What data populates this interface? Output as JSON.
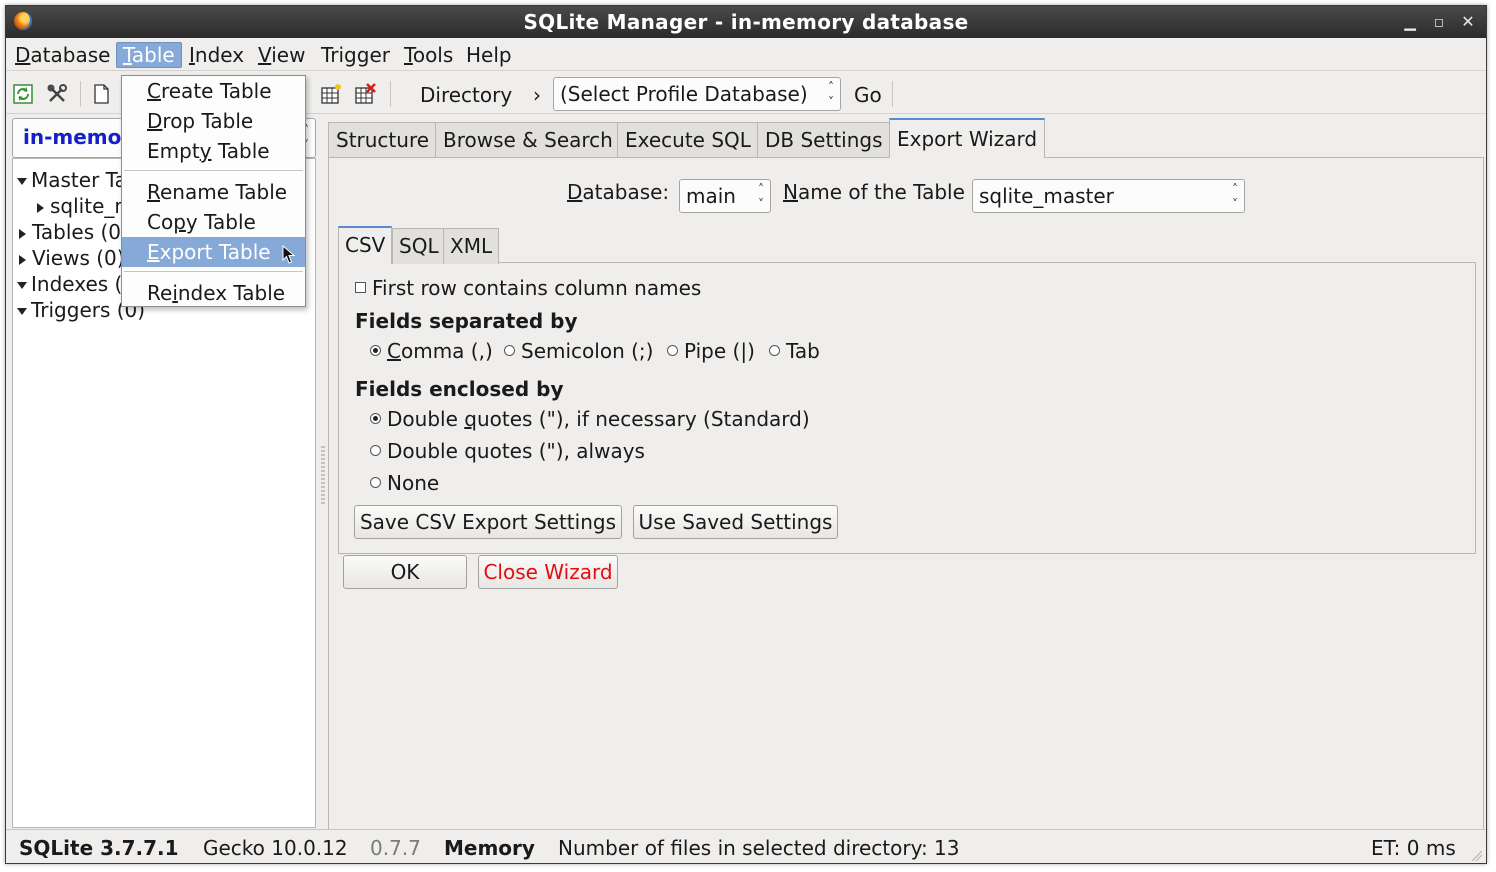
{
  "window": {
    "title": "SQLite Manager - in-memory database"
  },
  "menubar": {
    "items": [
      {
        "label": "Database",
        "mnemonic": "D",
        "rest": "atabase"
      },
      {
        "label": "Table",
        "mnemonic": "T",
        "rest": "able"
      },
      {
        "label": "Index",
        "mnemonic": "I",
        "rest": "ndex"
      },
      {
        "label": "View",
        "mnemonic": "V",
        "rest": "iew"
      },
      {
        "label": "Trigger",
        "mnemonic": "",
        "rest": "Trigger"
      },
      {
        "label": "Tools",
        "mnemonic": "T",
        "rest": "ools"
      },
      {
        "label": "Help",
        "mnemonic": "",
        "rest": "Help"
      }
    ]
  },
  "table_menu": {
    "create": {
      "pre": "",
      "mn": "C",
      "post": "reate Table"
    },
    "drop": {
      "pre": "",
      "mn": "D",
      "post": "rop Table"
    },
    "empty": {
      "pre": "Empt",
      "mn": "y",
      "post": " Table"
    },
    "rename": {
      "pre": "",
      "mn": "R",
      "post": "ename Table"
    },
    "copy": {
      "pre": "Co",
      "mn": "p",
      "post": "y Table"
    },
    "export": {
      "pre": "",
      "mn": "E",
      "post": "xport Table"
    },
    "reindex": {
      "pre": "Re",
      "mn": "i",
      "post": "ndex Table"
    }
  },
  "toolbar": {
    "directory_label": "Directory",
    "chevron": "›",
    "profile_select": "(Select Profile Database)",
    "go_label": "Go"
  },
  "left_panel": {
    "db_select": "in-memory",
    "tree": {
      "master": "Master Tables (1)",
      "sqlite_master": "sqlite_master",
      "tables": "Tables (0)",
      "views": "Views (0)",
      "indexes": "Indexes (0)",
      "triggers": "Triggers (0)"
    }
  },
  "tabs": [
    "Structure",
    "Browse & Search",
    "Execute SQL",
    "DB Settings",
    "Export Wizard"
  ],
  "export": {
    "database_label_mn": "D",
    "database_label_rest": "atabase:",
    "database_value": "main",
    "table_label_mn": "N",
    "table_label_rest": "ame of the Table",
    "table_value": "sqlite_master",
    "subtabs": [
      "CSV",
      "SQL",
      "XML"
    ],
    "first_row": "First row contains column names",
    "separated_heading": "Fields separated by",
    "sep_comma_mn": "C",
    "sep_comma_rest": "omma (,)",
    "sep_semicolon": "Semicolon (;)",
    "sep_pipe": "Pipe (|)",
    "sep_tab": "Tab",
    "enclosed_heading": "Fields enclosed by",
    "enc_std_pre": "Double ",
    "enc_std_mn": "q",
    "enc_std_post": "uotes (\"), if necessary (Standard)",
    "enc_always": "Double quotes (\"), always",
    "enc_none": "None",
    "save_settings": "Save CSV Export Settings",
    "use_saved": "Use Saved Settings",
    "ok": "OK",
    "close_wizard": "Close Wizard"
  },
  "status": {
    "sqlite_version": "SQLite 3.7.7.1",
    "gecko": "Gecko 10.0.12",
    "ext_version": "0.7.7",
    "memory": "Memory",
    "files_info": "Number of files in selected directory: 13",
    "elapsed": "ET: 0 ms"
  },
  "colors": {
    "accent": "#86a9d8",
    "db_name": "#1520c8",
    "danger": "#e01010"
  }
}
